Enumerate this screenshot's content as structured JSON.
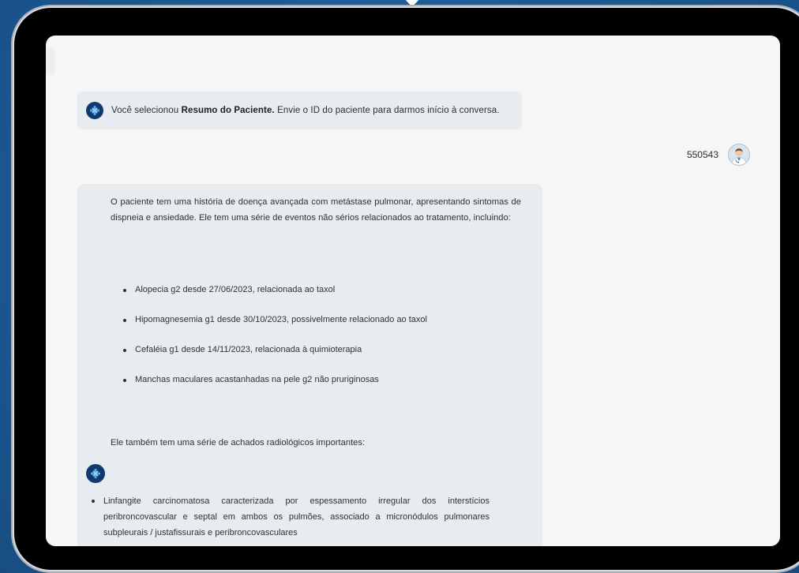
{
  "chat": {
    "intro": {
      "prefix": "Você selecionou ",
      "bold": "Resumo do Paciente.",
      "suffix": " Envie o ID do paciente para darmos início à conversa."
    },
    "user_message": "550543",
    "answer": {
      "paragraph1": "O paciente tem uma história de doença avançada com metástase pulmonar, apresentando sintomas de dispneia e ansiedade. Ele tem uma série de eventos não sérios relacionados ao tratamento, incluindo:",
      "events": [
        "Alopecia g2 desde 27/06/2023, relacionada ao taxol",
        "Hipomagnesemia g1 desde 30/10/2023, possivelmente relacionado ao taxol",
        "Cefaléia g1 desde 14/11/2023, relacionada à quimioterapia",
        "Manchas maculares acastanhadas na pele g2 não pruriginosas"
      ],
      "paragraph2": "Ele também tem uma série de achados radiológicos importantes:",
      "findings": [
        "Linfangite carcinomatosa caracterizada por espessamento irregular dos interstícios peribroncovascular e septal em ambos os pulmões, associado a micronódulos pulmonares subpleurais / justafissurais e peribroncovasculares"
      ]
    }
  },
  "icons": {
    "bot": "medical-cross-icon",
    "user": "doctor-avatar"
  },
  "colors": {
    "background": "#1a5690",
    "bot_avatar": "#0d3b6e",
    "bubble": "#e7ecf1",
    "screen": "#f6f6f7"
  }
}
